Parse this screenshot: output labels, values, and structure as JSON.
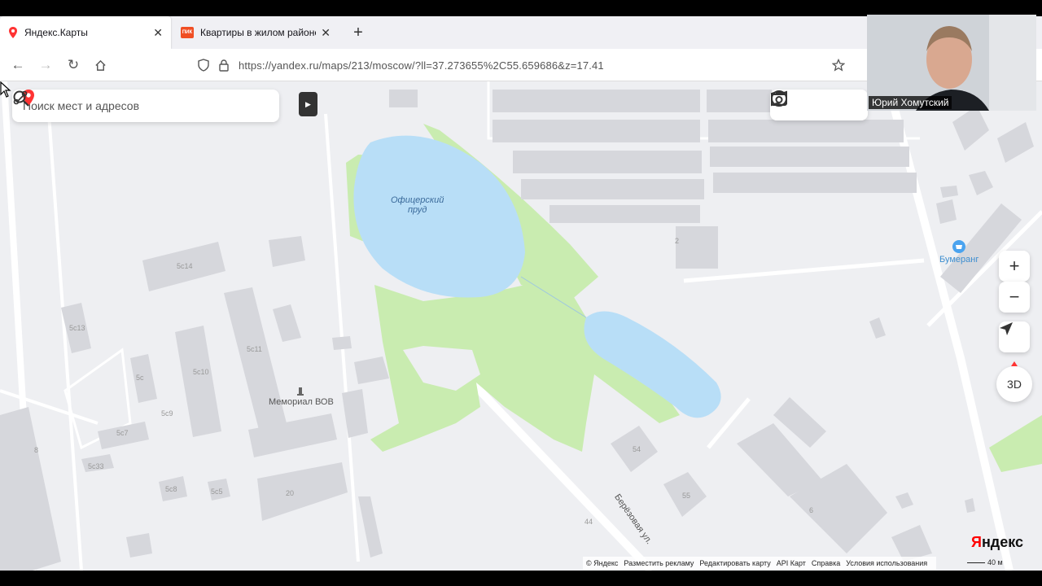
{
  "browser": {
    "tabs": [
      {
        "title": "Яндекс.Карты",
        "favicon": "pin-icon"
      },
      {
        "title": "Квартиры в жилом районе Од",
        "favicon": "pik-icon",
        "favicon_text": "ПИК"
      }
    ],
    "url": "https://yandex.ru/maps/213/moscow/?ll=37.273655%2C55.659686&z=17.41"
  },
  "search": {
    "placeholder": "Поиск мест и адресов"
  },
  "map": {
    "water": [
      {
        "name": "Офицерский\nпруд"
      }
    ],
    "pois": [
      {
        "name": "Мемориал ВОВ"
      },
      {
        "name": "Бумеранг"
      }
    ],
    "street": "Берёзовая ул.",
    "building_numbers": [
      "5с14",
      "5с13",
      "5с11",
      "5с10",
      "5с",
      "5с9",
      "5с7",
      "5с33",
      "5с8",
      "5с5",
      "20",
      "2",
      "54",
      "55",
      "6",
      "44",
      "8"
    ],
    "controls": {
      "zoom_in": "+",
      "zoom_out": "−",
      "three_d": "3D"
    }
  },
  "footer": {
    "copyright": "© Яндекс",
    "links": [
      "Разместить рекламу",
      "Редактировать карту",
      "API Карт",
      "Справка",
      "Условия использования"
    ],
    "logo": "Яндекс",
    "scale": "40 м"
  },
  "webcam": {
    "name": "Юрий Хомутский"
  },
  "colors": {
    "water": "#b8def7",
    "park": "#c9ecb0",
    "building": "#d6d7dc",
    "map_bg": "#eeeff2",
    "accent_red": "#f33"
  }
}
